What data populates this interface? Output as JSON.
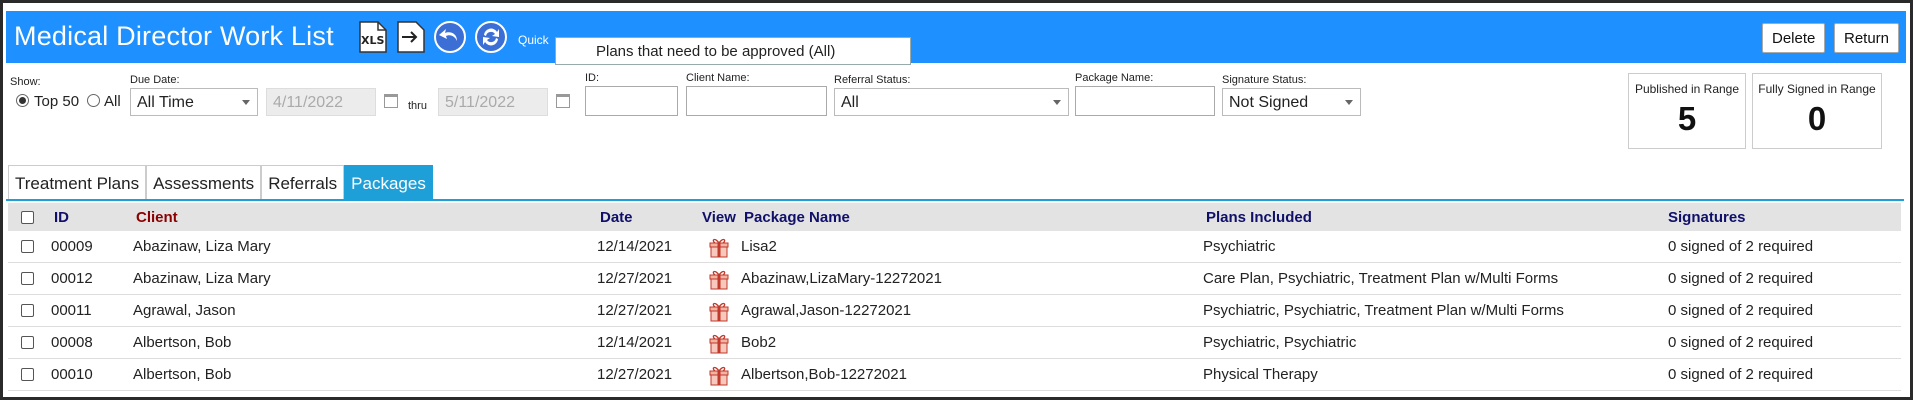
{
  "header": {
    "title": "Medical Director Work List",
    "xls_icon": "xls-export-icon",
    "quick_label": "Quick",
    "filter_selected": "Plans that need to be approved (All)",
    "delete_label": "Delete",
    "return_label": "Return",
    "colors": {
      "header_bg": "#1e90ff",
      "tab_active": "#1e9fd8"
    }
  },
  "filters": {
    "show_label": "Show:",
    "top50_label": "Top 50",
    "all_label": "All",
    "due_date_label": "Due Date:",
    "due_date_value": "All Time",
    "date_from": "4/11/2022",
    "thru_label": "thru",
    "date_to": "5/11/2022",
    "id_label": "ID:",
    "id_value": "",
    "client_name_label": "Client Name:",
    "client_name_value": "",
    "referral_status_label": "Referral Status:",
    "referral_status_value": "All",
    "package_name_label": "Package Name:",
    "package_name_value": "",
    "signature_status_label": "Signature Status:",
    "signature_status_value": "Not Signed"
  },
  "stats": {
    "published": {
      "label": "Published in Range",
      "value": "5"
    },
    "fully_signed": {
      "label": "Fully Signed in Range",
      "value": "0"
    }
  },
  "tabs": [
    "Treatment Plans",
    "Assessments",
    "Referrals",
    "Packages"
  ],
  "table": {
    "headers": {
      "id": "ID",
      "client": "Client",
      "date": "Date",
      "view": "View",
      "package_name": "Package Name",
      "plans_included": "Plans Included",
      "signatures": "Signatures"
    },
    "rows": [
      {
        "id": "00009",
        "client": "Abazinaw, Liza Mary",
        "date": "12/14/2021",
        "package": "Lisa2",
        "plans": "Psychiatric",
        "signatures": "0 signed of 2 required"
      },
      {
        "id": "00012",
        "client": "Abazinaw, Liza Mary",
        "date": "12/27/2021",
        "package": "Abazinaw,LizaMary-12272021",
        "plans": "Care Plan, Psychiatric, Treatment Plan w/Multi Forms",
        "signatures": "0 signed of 2 required"
      },
      {
        "id": "00011",
        "client": "Agrawal, Jason",
        "date": "12/27/2021",
        "package": "Agrawal,Jason-12272021",
        "plans": "Psychiatric, Psychiatric, Treatment Plan w/Multi Forms",
        "signatures": "0 signed of 2 required"
      },
      {
        "id": "00008",
        "client": "Albertson, Bob",
        "date": "12/14/2021",
        "package": "Bob2",
        "plans": "Psychiatric, Psychiatric",
        "signatures": "0 signed of 2 required"
      },
      {
        "id": "00010",
        "client": "Albertson, Bob",
        "date": "12/27/2021",
        "package": "Albertson,Bob-12272021",
        "plans": "Physical Therapy",
        "signatures": "0 signed of 2 required"
      }
    ]
  }
}
